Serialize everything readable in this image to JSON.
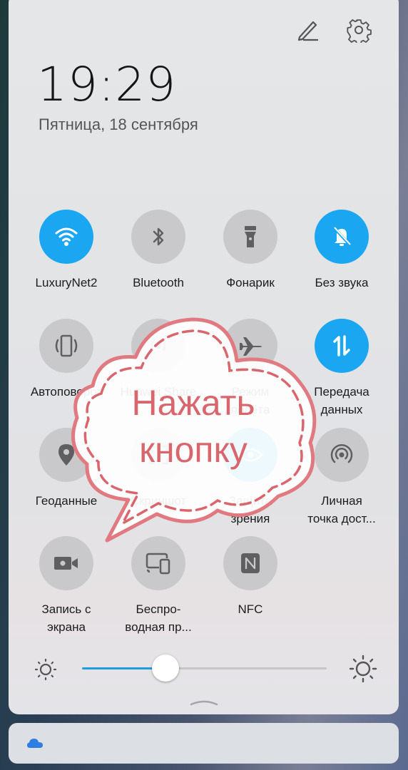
{
  "header": {
    "edit_icon": "pencil-icon",
    "settings_icon": "gear-icon",
    "time": "19:29",
    "date": "Пятница, 18 сентября"
  },
  "colors": {
    "accent": "#1aa6f0",
    "inactive_tile": "#c9c9cb",
    "icon_gray": "#5f5f61",
    "bubble_red": "#d9666c"
  },
  "tiles": [
    {
      "label": "LuxuryNet2",
      "icon": "wifi-icon",
      "active": true
    },
    {
      "label": "Bluetooth",
      "icon": "bluetooth-icon",
      "active": false
    },
    {
      "label": "Фонарик",
      "icon": "flashlight-icon",
      "active": false
    },
    {
      "label": "Без звука",
      "icon": "bell-off-icon",
      "active": true
    },
    {
      "label": "Автоповорот",
      "icon": "auto-rotate-icon",
      "active": false
    },
    {
      "label": "Huawei Share",
      "icon": "huawei-share-icon",
      "active": false
    },
    {
      "label_line1": "Режим",
      "label_line2": "полёта",
      "icon": "airplane-icon",
      "active": false
    },
    {
      "label_line1": "Передача",
      "label_line2": "данных",
      "icon": "mobile-data-icon",
      "active": true
    },
    {
      "label": "Геоданные",
      "icon": "location-icon",
      "active": false
    },
    {
      "label": "Скриншот",
      "icon": "screenshot-icon",
      "active": false
    },
    {
      "label_line1": "Защита",
      "label_line2": "зрения",
      "icon": "eye-comfort-icon",
      "active": true
    },
    {
      "label_line1": "Личная",
      "label_line2": "точка дост...",
      "icon": "hotspot-icon",
      "active": false
    },
    {
      "label_line1": "Запись с",
      "label_line2": "экрана",
      "icon": "screen-record-icon",
      "active": false
    },
    {
      "label_line1": "Беспро-",
      "label_line2": "водная пр...",
      "icon": "wireless-projection-icon",
      "active": false
    },
    {
      "label": "NFC",
      "icon": "nfc-icon",
      "active": false
    }
  ],
  "brightness": {
    "level_fraction": 0.34,
    "min_icon": "brightness-low-icon",
    "max_icon": "brightness-high-icon"
  },
  "notification": {
    "icon": "cloud-icon"
  },
  "overlay": {
    "line1": "Нажать",
    "line2": "кнопку"
  }
}
